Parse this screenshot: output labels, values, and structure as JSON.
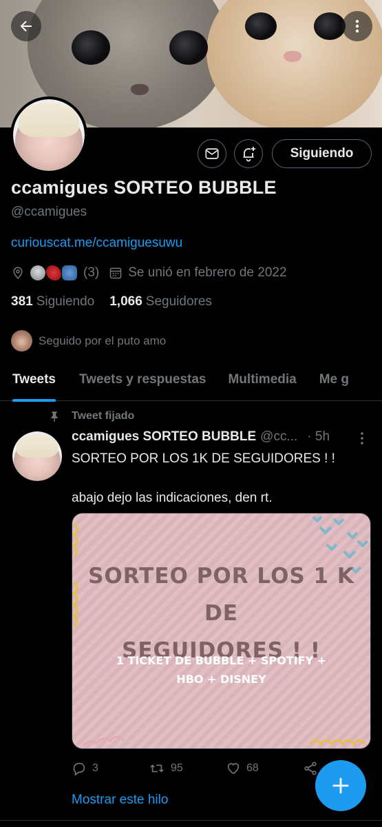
{
  "profile": {
    "name": "ccamigues SORTEO BUBBLE",
    "handle": "@ccamigues",
    "link": "curiouscat.me/ccamiguesuwu",
    "emoji_count": "(3)",
    "joined": "Se unió en febrero de 2022",
    "following_count": "381",
    "following_label": "Siguiendo",
    "followers_count": "1,066",
    "followers_label": "Seguidores",
    "followed_by": "Seguido por el puto amo",
    "follow_button": "Siguiendo"
  },
  "tabs": [
    {
      "label": "Tweets",
      "active": true
    },
    {
      "label": "Tweets y respuestas",
      "active": false
    },
    {
      "label": "Multimedia",
      "active": false
    },
    {
      "label": "Me g",
      "active": false
    }
  ],
  "tweet": {
    "pinned_label": "Tweet fijado",
    "author": "ccamigues SORTEO BUBBLE",
    "handle": "@cc...",
    "time": "· 5h",
    "text_line1": "SORTEO POR LOS 1K DE SEGUIDORES ! !",
    "text_line2": "abajo dejo las indicaciones, den rt.",
    "media_title_line1": "SORTEO POR LOS 1 K DE",
    "media_title_line2": "SEGUIDORES ! !",
    "media_sub_line1": "1 TICKET DE BUBBLE + SPOTIFY +",
    "media_sub_line2": "HBO + DISNEY",
    "replies": "3",
    "retweets": "95",
    "likes": "68",
    "show_thread": "Mostrar este hilo"
  },
  "colors": {
    "accent": "#1d9bf0",
    "background": "#000000",
    "secondary_text": "#71767b"
  },
  "icons": [
    "back-arrow-icon",
    "more-vertical-icon",
    "mail-icon",
    "bell-plus-icon",
    "location-icon",
    "calendar-icon",
    "pin-icon",
    "reply-icon",
    "retweet-icon",
    "heart-icon",
    "share-icon",
    "plus-icon"
  ]
}
